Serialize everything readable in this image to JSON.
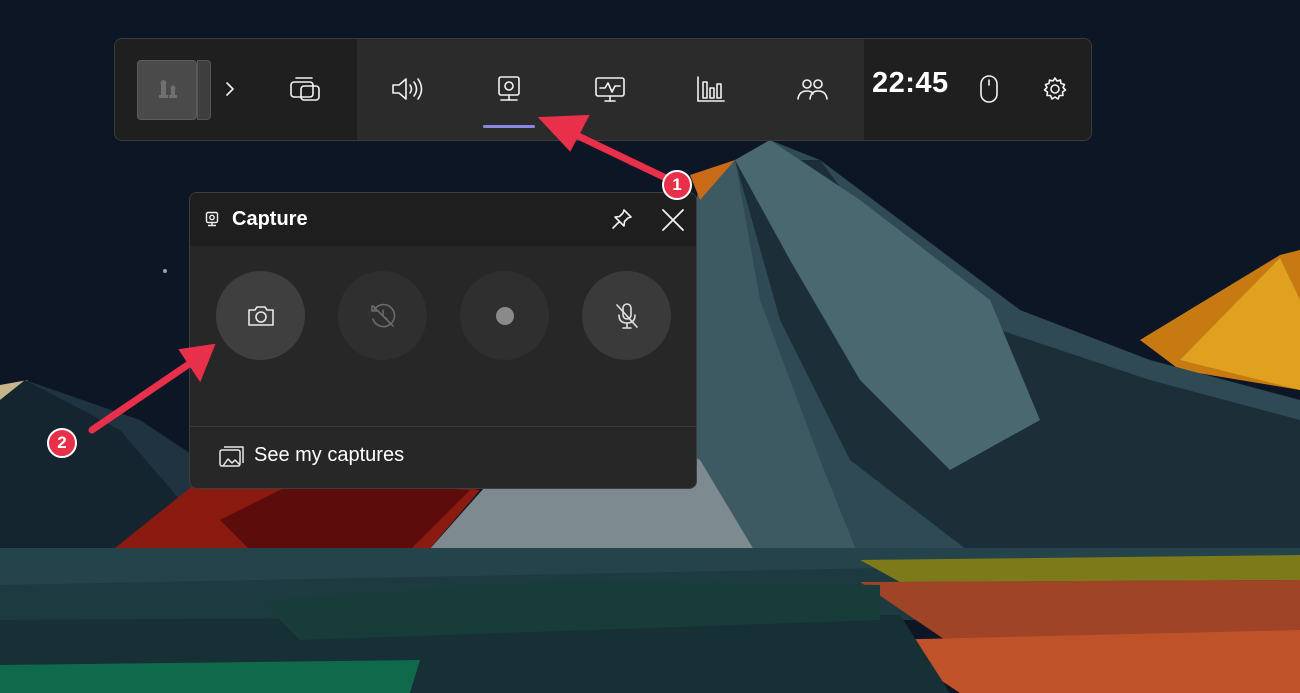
{
  "gamebar": {
    "widgets": [
      {
        "name": "expand-chevron-icon"
      },
      {
        "name": "widget-menu-icon"
      },
      {
        "name": "audio-icon"
      },
      {
        "name": "capture-icon"
      },
      {
        "name": "performance-icon"
      },
      {
        "name": "resources-icon"
      },
      {
        "name": "xbox-social-icon"
      },
      {
        "name": "mouse-icon"
      },
      {
        "name": "settings-gear-icon"
      }
    ],
    "active_widget": "capture-icon",
    "time": "22:45",
    "accent_color": "#8b87e0"
  },
  "capture_widget": {
    "title": "Capture",
    "buttons": [
      {
        "name": "screenshot-button",
        "icon": "camera-icon",
        "enabled": true
      },
      {
        "name": "record-last-30s-button",
        "icon": "record-history-icon",
        "enabled": false
      },
      {
        "name": "start-recording-button",
        "icon": "record-dot-icon",
        "enabled": false
      },
      {
        "name": "mic-toggle-button",
        "icon": "mic-off-icon",
        "enabled": true
      }
    ],
    "footer_label": "See my captures"
  },
  "annotations": {
    "badge_1": "1",
    "badge_2": "2",
    "color": "#e8304a"
  }
}
